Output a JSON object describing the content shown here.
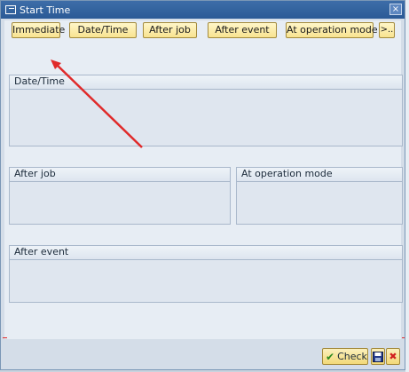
{
  "dialog": {
    "title": "Start Time",
    "close_glyph": "×"
  },
  "toolbar": {
    "buttons": [
      {
        "label": "Immediate"
      },
      {
        "label": "Date/Time"
      },
      {
        "label": "After job"
      },
      {
        "label": "After event"
      },
      {
        "label": "At operation mode"
      },
      {
        "label": ">.."
      }
    ]
  },
  "groups": {
    "datetime": "Date/Time",
    "after_job": "After job",
    "op_mode": "At operation mode",
    "after_event": "After event"
  },
  "footer": {
    "check_label": "Check",
    "save_icon": "floppy-disk-icon",
    "cancel_icon": "cancel-x-icon"
  },
  "colors": {
    "titlebar": "#2b5a96",
    "button_fill": "#f8e390",
    "annotation_arrow": "#e02a2a"
  }
}
